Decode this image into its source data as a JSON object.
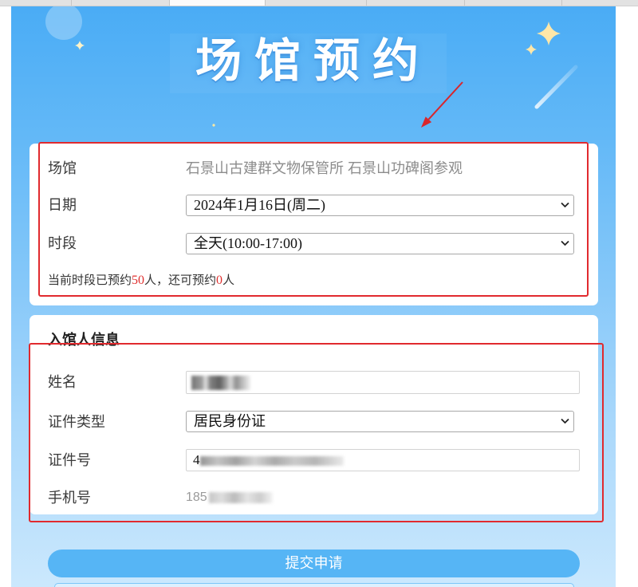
{
  "page": {
    "title": "场馆预约"
  },
  "booking": {
    "venue_label": "场馆",
    "venue_value": "石景山古建群文物保管所 石景山功碑阁参观",
    "date_label": "日期",
    "date_value": "2024年1月16日(周二)",
    "slot_label": "时段",
    "slot_value": "全天(10:00-17:00)",
    "quota": {
      "text_before": "当前时段已预约",
      "booked": "50",
      "text_middle": "人，还可预约",
      "remaining": "0",
      "text_after": "人"
    }
  },
  "visitor": {
    "heading": "入馆人信息",
    "name_label": "姓名",
    "id_type_label": "证件类型",
    "id_type_value": "居民身份证",
    "id_number_label": "证件号",
    "id_number_visible": "4",
    "phone_label": "手机号",
    "phone_visible": "185"
  },
  "actions": {
    "submit_label": "提交申请"
  },
  "icons": {
    "select_arrow": "chevron-down-icon",
    "decoration": "sparkle-icon"
  },
  "colors": {
    "background_top": "#4aacf5",
    "background_bottom": "#cbe8fd",
    "accent": "#56b5f5",
    "count_highlight": "#e0302f",
    "annotation": "#e12a2e",
    "label_text": "#3a3a3a",
    "muted_text": "#8c8c8c"
  }
}
